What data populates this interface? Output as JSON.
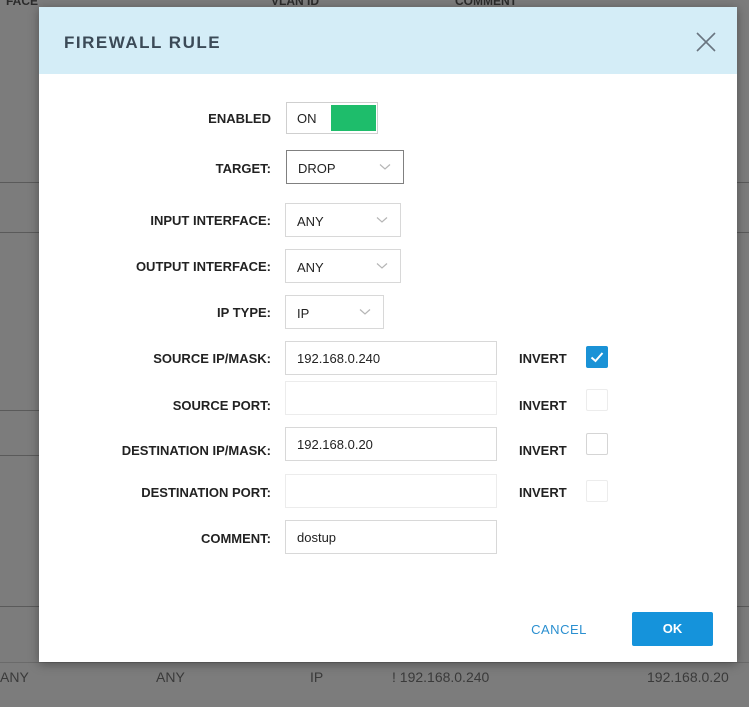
{
  "background": {
    "header_columns": [
      "FACE",
      "VLAN ID",
      "COMMENT"
    ],
    "row": {
      "input": "ANY",
      "output": "ANY",
      "ip_type": "IP",
      "source": "! 192.168.0.240",
      "destination": "192.168.0.20"
    }
  },
  "dialog": {
    "title": "FIREWALL RULE",
    "close_icon": "close-icon",
    "fields": {
      "enabled": {
        "label": "ENABLED",
        "value": "ON",
        "on": true
      },
      "target": {
        "label": "TARGET:",
        "value": "DROP"
      },
      "input_interface": {
        "label": "INPUT INTERFACE:",
        "value": "ANY"
      },
      "output_interface": {
        "label": "OUTPUT INTERFACE:",
        "value": "ANY"
      },
      "ip_type": {
        "label": "IP TYPE:",
        "value": "IP"
      },
      "source_ip": {
        "label": "SOURCE IP/MASK:",
        "value": "192.168.0.240",
        "invert_label": "INVERT",
        "invert": true
      },
      "source_port": {
        "label": "SOURCE PORT:",
        "value": "",
        "invert_label": "INVERT",
        "invert": false
      },
      "dest_ip": {
        "label": "DESTINATION IP/MASK:",
        "value": "192.168.0.20",
        "invert_label": "INVERT",
        "invert": false
      },
      "dest_port": {
        "label": "DESTINATION PORT:",
        "value": "",
        "invert_label": "INVERT",
        "invert": false
      },
      "comment": {
        "label": "COMMENT:",
        "value": "dostup"
      }
    },
    "buttons": {
      "cancel": "CANCEL",
      "ok": "OK"
    }
  },
  "colors": {
    "header_bg": "#d4edf7",
    "toggle_on": "#1ebd6b",
    "primary": "#1593db",
    "link": "#2a8fd0",
    "overlay": "#7c7c7c"
  }
}
